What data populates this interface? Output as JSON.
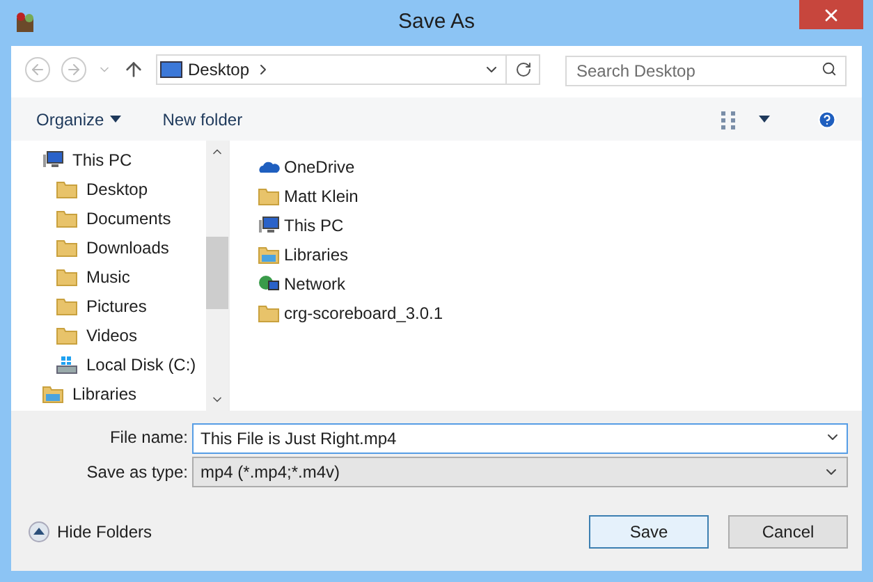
{
  "window": {
    "title": "Save As"
  },
  "nav": {
    "location": "Desktop",
    "search": {
      "placeholder": "Search Desktop"
    }
  },
  "toolbar": {
    "organize": "Organize",
    "new_folder": "New folder"
  },
  "sidebar": {
    "items": [
      {
        "label": "This PC",
        "kind": "pc",
        "children": [
          {
            "label": "Desktop",
            "kind": "folder"
          },
          {
            "label": "Documents",
            "kind": "folder"
          },
          {
            "label": "Downloads",
            "kind": "folder"
          },
          {
            "label": "Music",
            "kind": "folder"
          },
          {
            "label": "Pictures",
            "kind": "folder"
          },
          {
            "label": "Videos",
            "kind": "folder"
          },
          {
            "label": "Local Disk (C:)",
            "kind": "disk"
          }
        ]
      },
      {
        "label": "Libraries",
        "kind": "library"
      }
    ]
  },
  "files": [
    {
      "name": "OneDrive",
      "kind": "cloud"
    },
    {
      "name": "Matt Klein",
      "kind": "folder"
    },
    {
      "name": "This PC",
      "kind": "pc"
    },
    {
      "name": "Libraries",
      "kind": "library"
    },
    {
      "name": "Network",
      "kind": "network"
    },
    {
      "name": "crg-scoreboard_3.0.1",
      "kind": "folder"
    }
  ],
  "form": {
    "file_name_label": "File name:",
    "file_name": "This File is Just Right.mp4",
    "type_label": "Save as type:",
    "type": "mp4 (*.mp4;*.m4v)"
  },
  "footer": {
    "hide_folders": "Hide Folders",
    "buttons": [
      {
        "label": "Save",
        "default": true
      },
      {
        "label": "Cancel",
        "default": false
      }
    ]
  }
}
